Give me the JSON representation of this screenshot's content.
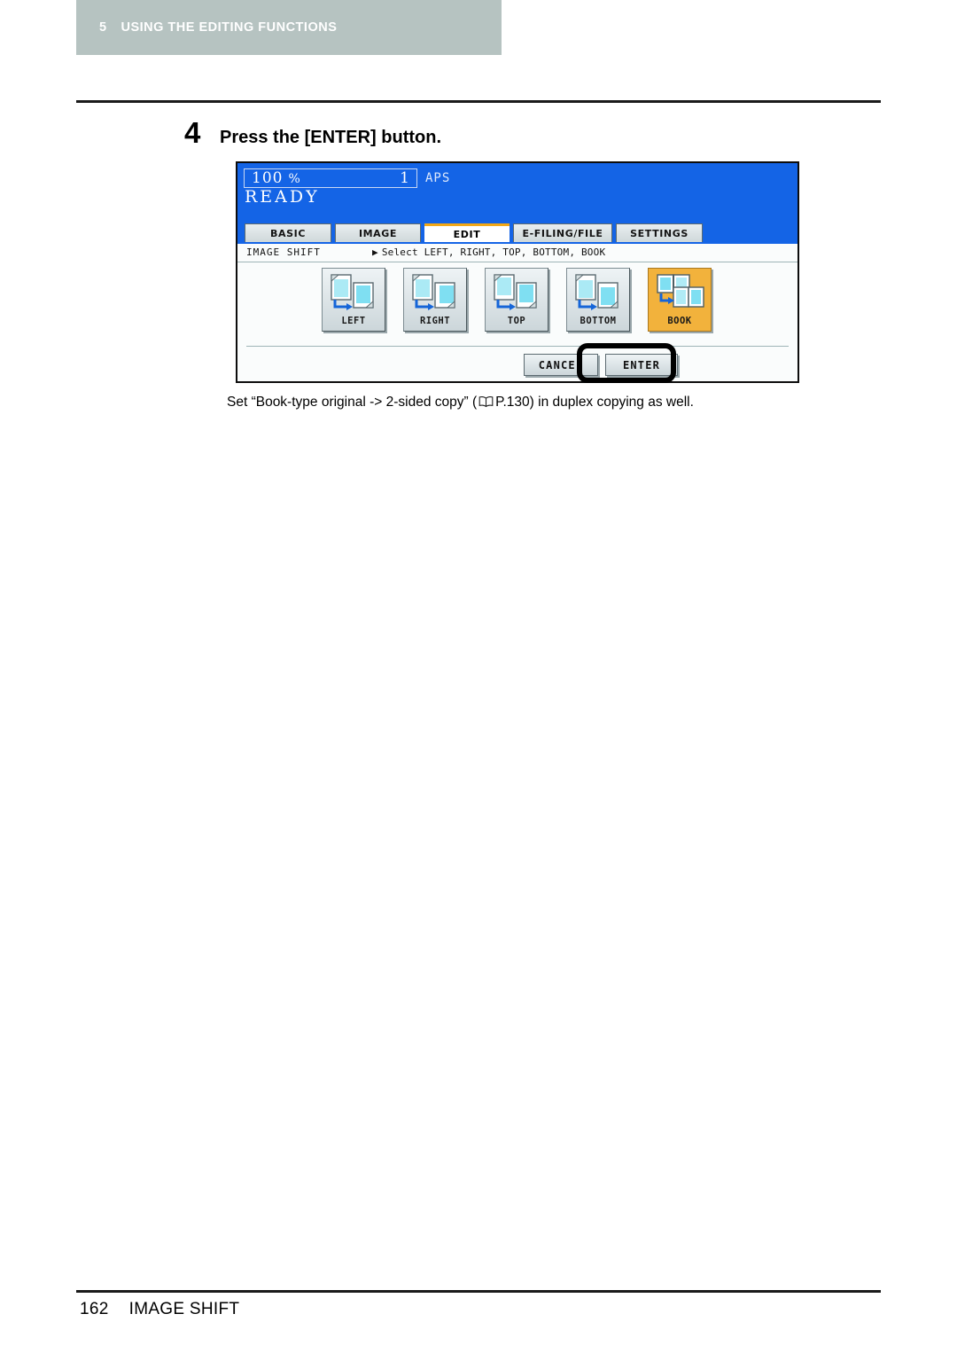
{
  "running_header": {
    "chapter_number": "5",
    "chapter_title": "USING THE EDITING FUNCTIONS",
    "band_color": "#b6c3c1"
  },
  "step": {
    "number": "4",
    "instruction": "Press the [ENTER] button."
  },
  "lcd": {
    "status": {
      "zoom_ratio": "100",
      "percent_sign": "%",
      "copy_count": "1",
      "paper_mode": "APS",
      "machine_status": "READY",
      "background_color": "#1464e6"
    },
    "tabs": [
      {
        "label": "BASIC",
        "active": false
      },
      {
        "label": "IMAGE",
        "active": false
      },
      {
        "label": "EDIT",
        "active": true
      },
      {
        "label": "E-FILING/FILE",
        "active": false
      },
      {
        "label": "SETTINGS",
        "active": false
      }
    ],
    "active_tab_accent": "#f2a818",
    "function_header": {
      "name": "IMAGE SHIFT",
      "caret": "▶",
      "hint": "Select LEFT, RIGHT, TOP, BOTTOM, BOOK"
    },
    "mode_buttons": [
      {
        "label": "LEFT",
        "icon": "shift-left-icon",
        "selected": false
      },
      {
        "label": "RIGHT",
        "icon": "shift-right-icon",
        "selected": false
      },
      {
        "label": "TOP",
        "icon": "shift-top-icon",
        "selected": false
      },
      {
        "label": "BOTTOM",
        "icon": "shift-bottom-icon",
        "selected": false
      },
      {
        "label": "BOOK",
        "icon": "shift-book-icon",
        "selected": true
      }
    ],
    "selected_highlight_color": "#f2b23c",
    "actions": {
      "cancel_label": "CANCEL",
      "enter_label": "ENTER"
    }
  },
  "caption": {
    "text_before": "Set “Book-type original -> 2-sided copy” (",
    "reference_icon": "book-reference-icon",
    "page_reference": "P.130",
    "text_after": ") in duplex copying as well."
  },
  "footer": {
    "page_number": "162",
    "section_title": "IMAGE SHIFT"
  }
}
